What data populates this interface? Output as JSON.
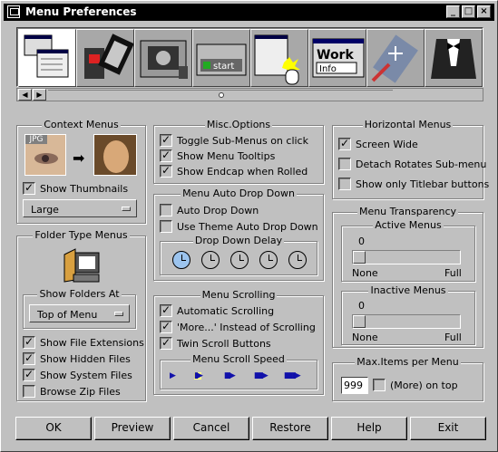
{
  "window": {
    "title": "Menu Preferences"
  },
  "thumbnails": [
    "menu-list-thumbnail",
    "film-thumbnail",
    "camera-thumbnail",
    "start-button-thumbnail",
    "menu-popup-thumbnail",
    "font-work-thumbnail",
    "paint-brush-thumbnail",
    "tuxedo-thumbnail"
  ],
  "thumb_texts": {
    "start": "start",
    "font_work": "Work",
    "font_info": "Info"
  },
  "context_menus": {
    "title": "Context Menus",
    "jpg_label": "JPG",
    "show_thumbnails": "Show Thumbnails",
    "size_value": "Large"
  },
  "misc_options": {
    "title": "Misc.Options",
    "items": [
      "Toggle Sub-Menus on click",
      "Show Menu Tooltips",
      "Show Endcap when Rolled"
    ]
  },
  "auto_drop": {
    "title": "Menu Auto Drop Down",
    "items": [
      "Auto Drop Down",
      "Use Theme Auto Drop Down"
    ],
    "delay_title": "Drop Down Delay"
  },
  "folder_menus": {
    "title": "Folder Type Menus",
    "show_folders_at": "Show Folders At",
    "position_value": "Top of Menu",
    "items": [
      "Show File Extensions",
      "Show Hidden Files",
      "Show System Files",
      "Browse Zip Files"
    ]
  },
  "menu_scrolling": {
    "title": "Menu Scrolling",
    "items": [
      "Automatic Scrolling",
      "'More...' Instead of Scrolling",
      "Twin Scroll Buttons"
    ],
    "speed_title": "Menu Scroll Speed"
  },
  "horizontal_menus": {
    "title": "Horizontal Menus",
    "items": [
      "Screen Wide",
      "Detach Rotates Sub-menu",
      "Show only Titlebar buttons"
    ]
  },
  "transparency": {
    "title": "Menu Transparency",
    "active_title": "Active Menus",
    "inactive_title": "Inactive Menus",
    "active_value": "0",
    "inactive_value": "0",
    "min_label": "None",
    "max_label": "Full",
    "active_level": 0,
    "inactive_level": 0
  },
  "max_items": {
    "title": "Max.Items per Menu",
    "value": "999",
    "more_on_top": "(More) on top"
  },
  "buttons": {
    "ok": "OK",
    "preview": "Preview",
    "cancel": "Cancel",
    "restore": "Restore",
    "help": "Help",
    "exit": "Exit"
  }
}
